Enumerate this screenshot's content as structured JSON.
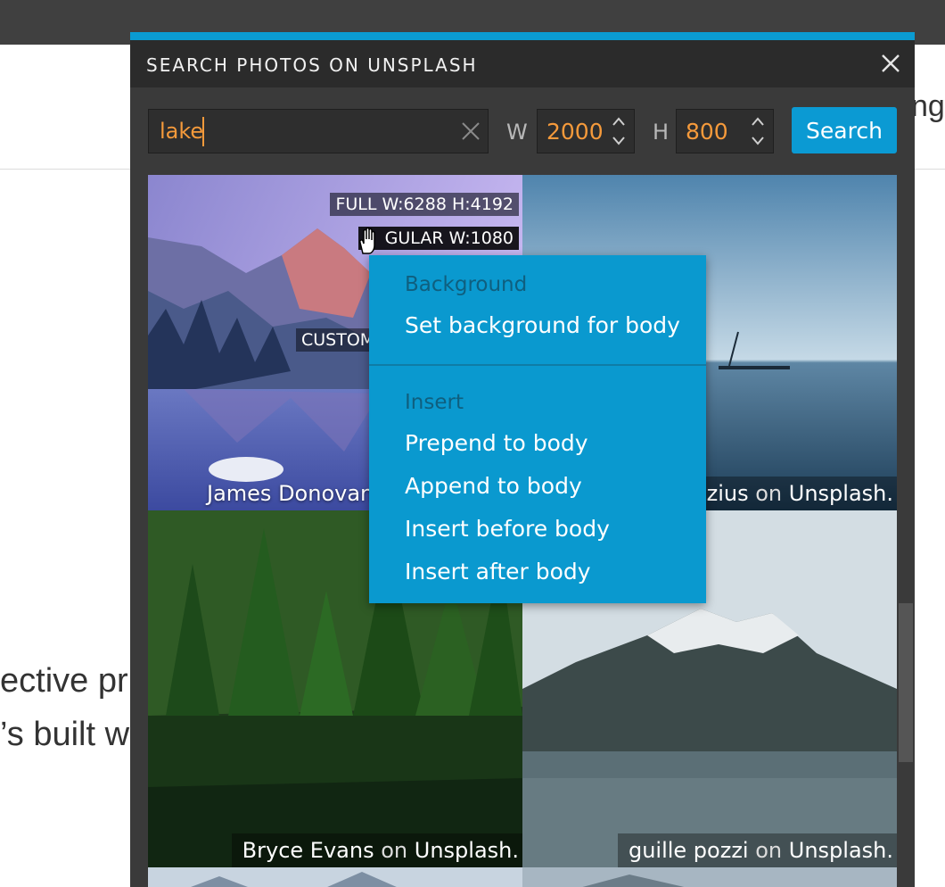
{
  "page": {
    "bg_text_line1": "ective pri",
    "bg_text_line2": "’s built wi",
    "bg_text_right": "ng"
  },
  "dialog": {
    "title": "SEARCH PHOTOS ON UNSPLASH",
    "accent_color": "#0a9bd1",
    "close_icon": "close-icon"
  },
  "search": {
    "query": "lake",
    "clear_icon": "clear-icon",
    "width_label": "W",
    "width_value": "2000",
    "height_label": "H",
    "height_value": "800",
    "button_label": "Search",
    "button_color": "#0b9ad3",
    "value_color": "#f59a3b"
  },
  "photos": [
    {
      "author": "James Donovan",
      "size_full": "FULL W:6288 H:4192",
      "size_regular": "GULAR W:1080",
      "size_custom": "CUSTOM"
    },
    {
      "author": "zius",
      "on": "on",
      "site": "Unsplash."
    },
    {
      "author": "Bryce Evans",
      "on": "on",
      "site": "Unsplash."
    },
    {
      "author": "guille pozzi",
      "on": "on",
      "site": "Unsplash."
    }
  ],
  "context_menu": {
    "background_heading": "Background",
    "set_background": "Set background for body",
    "insert_heading": "Insert",
    "prepend": "Prepend to body",
    "append": "Append to body",
    "insert_before": "Insert before body",
    "insert_after": "Insert after body",
    "color": "#0a99cf"
  }
}
